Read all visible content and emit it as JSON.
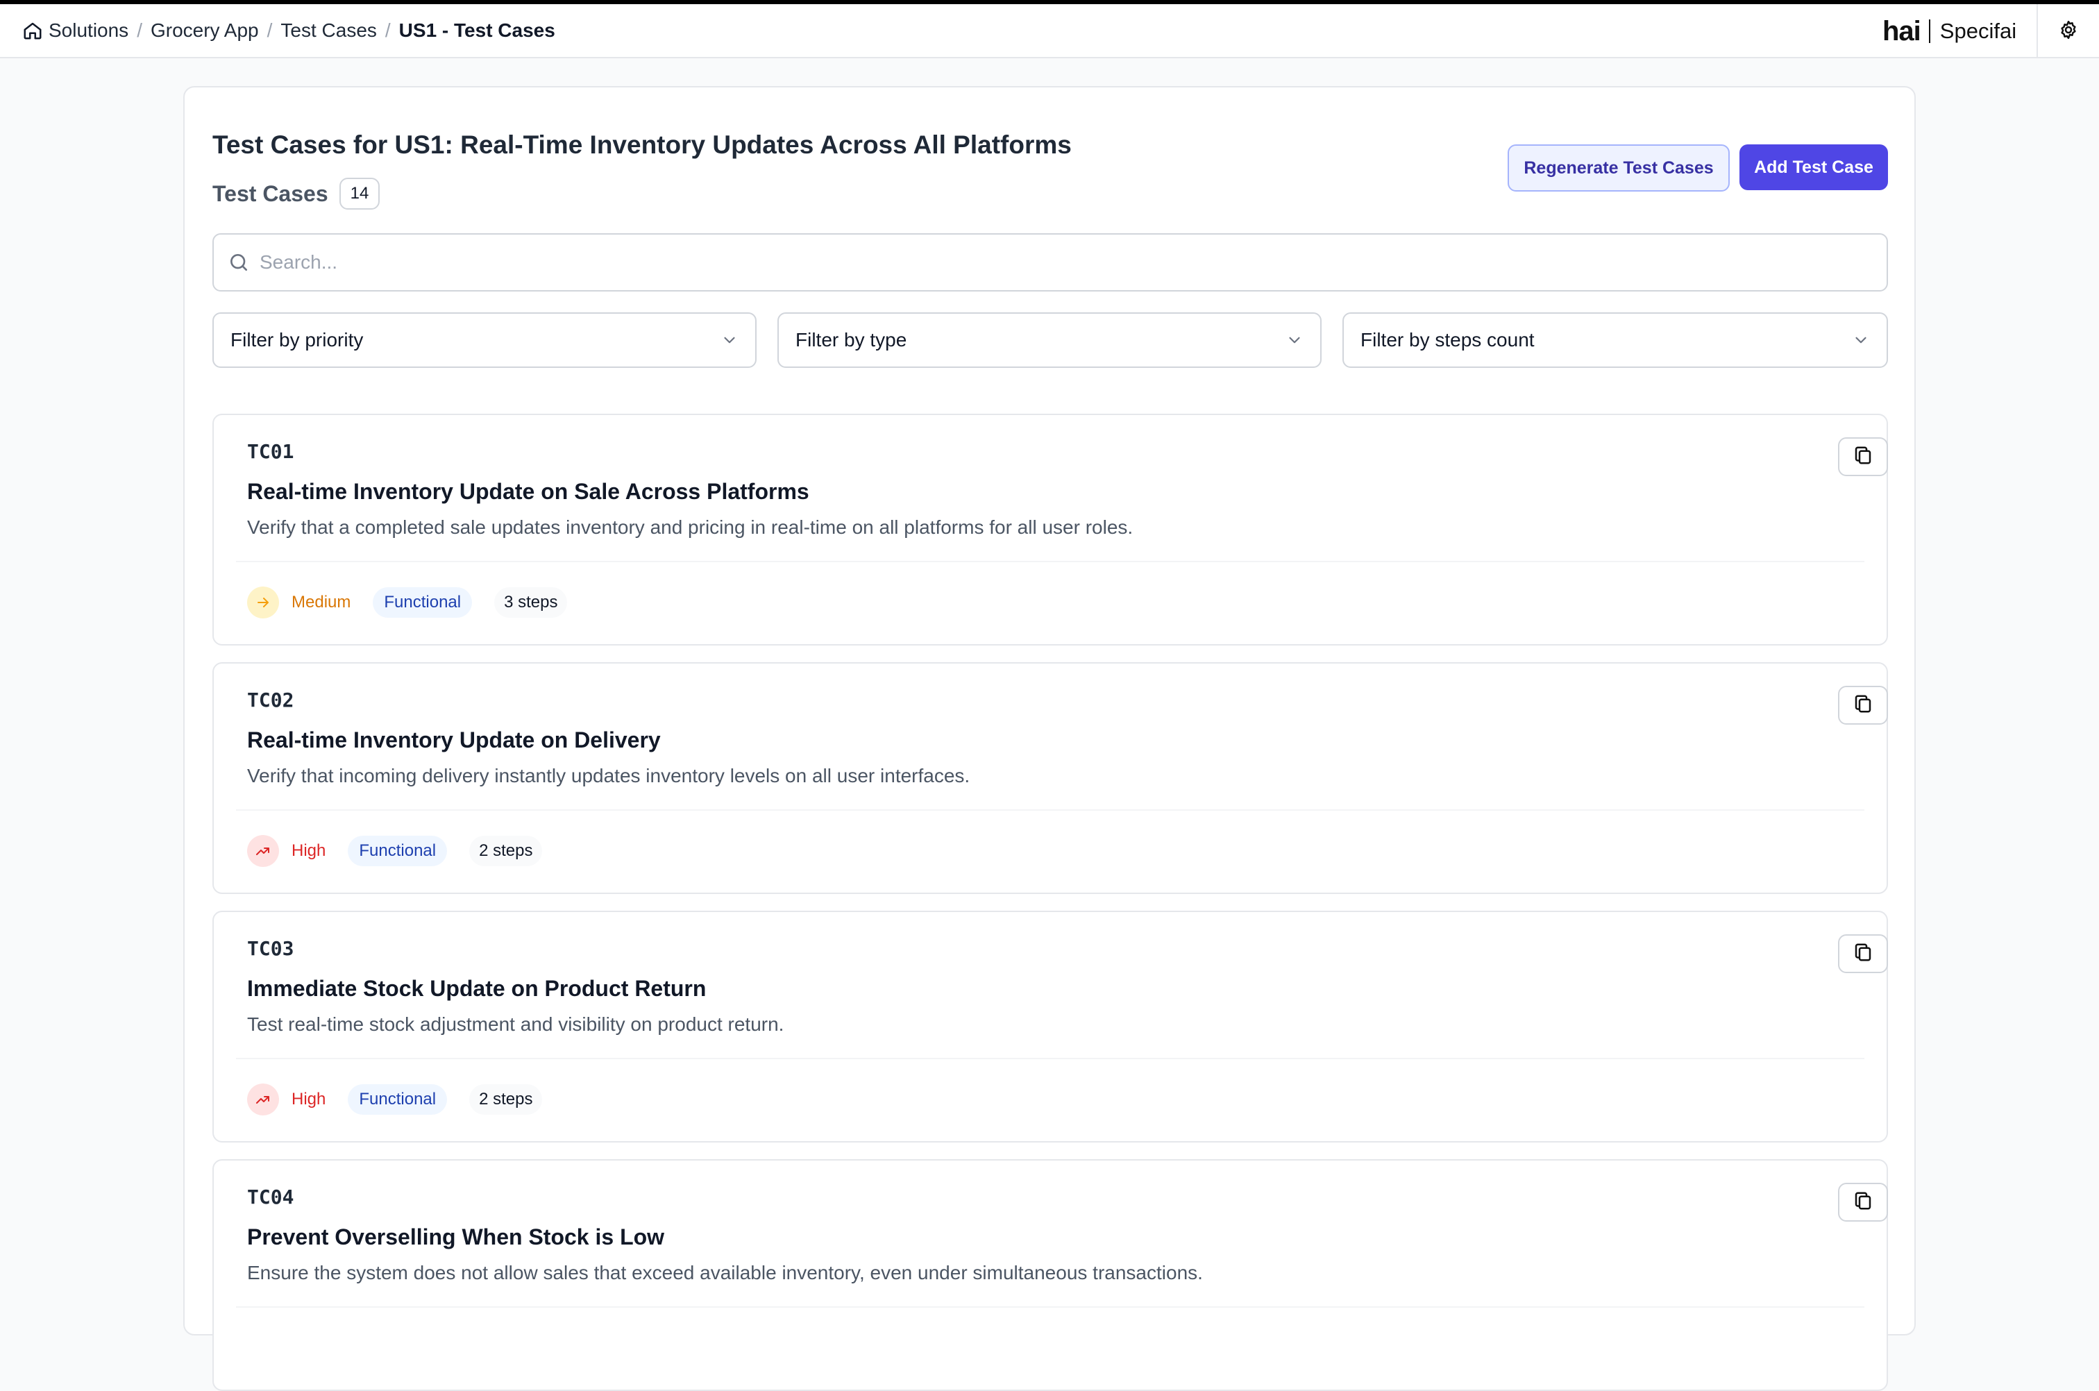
{
  "breadcrumb": {
    "items": [
      "Solutions",
      "Grocery App",
      "Test Cases"
    ],
    "current": "US1 - Test Cases"
  },
  "brand": {
    "logo": "hai",
    "name": "Specifai"
  },
  "page": {
    "title": "Test Cases for US1: Real-Time Inventory Updates Across All Platforms",
    "count_label": "Test Cases",
    "count": "14"
  },
  "actions": {
    "regenerate": "Regenerate Test Cases",
    "add": "Add Test Case"
  },
  "search": {
    "placeholder": "Search..."
  },
  "filters": {
    "priority": "Filter by priority",
    "type": "Filter by type",
    "steps": "Filter by steps count"
  },
  "test_cases": [
    {
      "id": "TC01",
      "title": "Real-time Inventory Update on Sale Across Platforms",
      "description": "Verify that a completed sale updates inventory and pricing in real-time on all platforms for all user roles.",
      "priority": "Medium",
      "type": "Functional",
      "steps": "3 steps"
    },
    {
      "id": "TC02",
      "title": "Real-time Inventory Update on Delivery",
      "description": "Verify that incoming delivery instantly updates inventory levels on all user interfaces.",
      "priority": "High",
      "type": "Functional",
      "steps": "2 steps"
    },
    {
      "id": "TC03",
      "title": "Immediate Stock Update on Product Return",
      "description": "Test real-time stock adjustment and visibility on product return.",
      "priority": "High",
      "type": "Functional",
      "steps": "2 steps"
    },
    {
      "id": "TC04",
      "title": "Prevent Overselling When Stock is Low",
      "description": "Ensure the system does not allow sales that exceed available inventory, even under simultaneous transactions."
    }
  ],
  "colors": {
    "accent": "#4f46e5",
    "priority_medium": "#d97706",
    "priority_high": "#dc2626",
    "type_pill_text": "#1e40af"
  }
}
